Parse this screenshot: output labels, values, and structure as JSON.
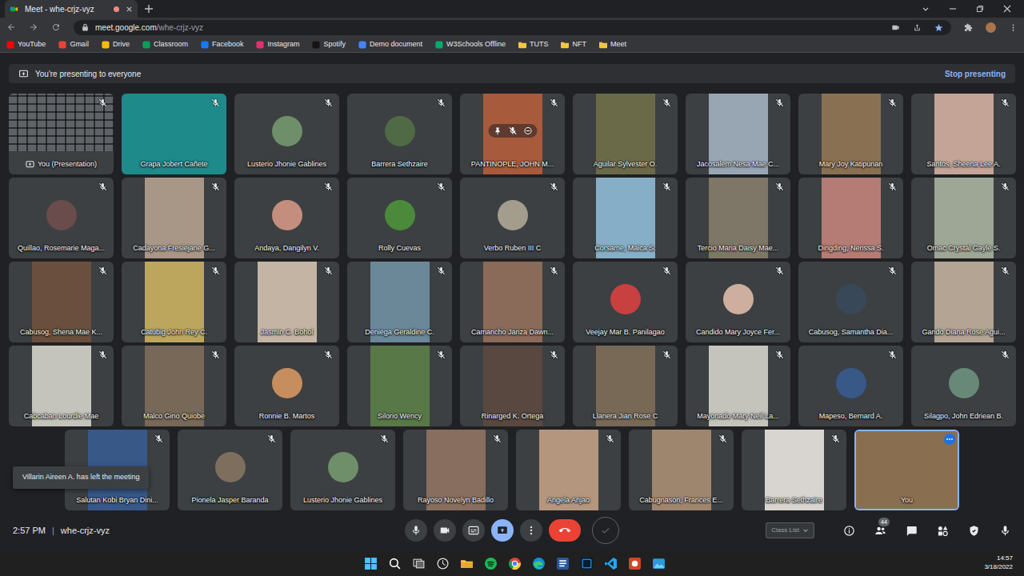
{
  "browser": {
    "tab": {
      "title": "Meet - whe-crjz-vyz",
      "recording": true
    },
    "address": {
      "host": "meet.google.com",
      "path": "/whe-crjz-vyz"
    },
    "bookmarks": [
      {
        "label": "YouTube",
        "kind": "site",
        "color": "#ff0000"
      },
      {
        "label": "Gmail",
        "kind": "site",
        "color": "#ea4335"
      },
      {
        "label": "Drive",
        "kind": "site",
        "color": "#fbbc04"
      },
      {
        "label": "Classroom",
        "kind": "site",
        "color": "#0f9d58"
      },
      {
        "label": "Facebook",
        "kind": "site",
        "color": "#1877f2"
      },
      {
        "label": "Instagram",
        "kind": "site",
        "color": "#e1306c"
      },
      {
        "label": "Spotify",
        "kind": "site",
        "color": "#191414"
      },
      {
        "label": "Demo document",
        "kind": "site",
        "color": "#4285f4"
      },
      {
        "label": "W3Schools Offline",
        "kind": "site",
        "color": "#04aa6d"
      },
      {
        "label": "TUTS",
        "kind": "folder",
        "color": "#f4c542"
      },
      {
        "label": "NFT",
        "kind": "folder",
        "color": "#f4c542"
      },
      {
        "label": "Meet",
        "kind": "folder",
        "color": "#f4c542"
      }
    ]
  },
  "meet": {
    "banner": {
      "text": "You're presenting to everyone",
      "action": "Stop presenting"
    },
    "tiles": [
      {
        "name": "You (Presentation)",
        "kind": "screen",
        "muted": true,
        "selected": false,
        "hovered": false,
        "color": "#5f6368"
      },
      {
        "name": "Grapa Jobert Cañete",
        "kind": "wide",
        "muted": true,
        "selected": false,
        "hovered": false,
        "color": "#1f8a8a"
      },
      {
        "name": "Lusterio Jhonie Gablines",
        "kind": "avatar",
        "muted": true,
        "selected": false,
        "hovered": false,
        "color": "#6f8f6a"
      },
      {
        "name": "Barrera Sethzaire",
        "kind": "avatar",
        "muted": true,
        "selected": false,
        "hovered": false,
        "color": "#4f6a45"
      },
      {
        "name": "PANTINOPLE, JOHN M...",
        "kind": "portrait",
        "muted": true,
        "selected": false,
        "hovered": true,
        "color": "#a85a3c"
      },
      {
        "name": "Aguilar Sylvester O.",
        "kind": "portrait",
        "muted": true,
        "selected": false,
        "hovered": false,
        "color": "#6b6a48"
      },
      {
        "name": "Jacosalem Nesa Mae C...",
        "kind": "portrait",
        "muted": true,
        "selected": false,
        "hovered": false,
        "color": "#98a6b4"
      },
      {
        "name": "Mary Joy Katipunan",
        "kind": "portrait",
        "muted": true,
        "selected": false,
        "hovered": false,
        "color": "#8a7052"
      },
      {
        "name": "Santos, Sheena Lee A.",
        "kind": "portrait",
        "muted": true,
        "selected": false,
        "hovered": false,
        "color": "#c4a496"
      },
      {
        "name": "Quillao, Rosemarie Maga...",
        "kind": "avatar",
        "muted": true,
        "selected": false,
        "hovered": false,
        "color": "#6a4c4c"
      },
      {
        "name": "Cadayona Fresiejane G...",
        "kind": "portrait",
        "muted": true,
        "selected": false,
        "hovered": false,
        "color": "#a89686"
      },
      {
        "name": "Andaya, Dangilyn V.",
        "kind": "avatar",
        "muted": true,
        "selected": false,
        "hovered": false,
        "color": "#c48e7e"
      },
      {
        "name": "Rolly Cuevas",
        "kind": "avatar",
        "muted": true,
        "selected": false,
        "hovered": false,
        "color": "#4a8a3a"
      },
      {
        "name": "Verbo Ruben III C",
        "kind": "avatar",
        "muted": true,
        "selected": false,
        "hovered": false,
        "color": "#a49c8c"
      },
      {
        "name": "Corsame, Maica S.",
        "kind": "portrait",
        "muted": true,
        "selected": false,
        "hovered": false,
        "color": "#86aec6"
      },
      {
        "name": "Tercio Maria Daisy Mae...",
        "kind": "portrait",
        "muted": true,
        "selected": false,
        "hovered": false,
        "color": "#7e7666"
      },
      {
        "name": "Dingding, Nerissa S.",
        "kind": "portrait",
        "muted": true,
        "selected": false,
        "hovered": false,
        "color": "#b47c74"
      },
      {
        "name": "Omac Crystal Gayle S.",
        "kind": "portrait",
        "muted": true,
        "selected": false,
        "hovered": false,
        "color": "#9ea696"
      },
      {
        "name": "Cabusog, Shena Mae K...",
        "kind": "portrait",
        "muted": true,
        "selected": false,
        "hovered": false,
        "color": "#6a4e3e"
      },
      {
        "name": "Catubig John Rey C.",
        "kind": "portrait",
        "muted": true,
        "selected": false,
        "hovered": false,
        "color": "#bca65e"
      },
      {
        "name": "Jasmin C. Bohol",
        "kind": "portrait",
        "muted": true,
        "selected": false,
        "hovered": false,
        "color": "#c4b4a4"
      },
      {
        "name": "Deniega Geraldine C.",
        "kind": "portrait",
        "muted": true,
        "selected": false,
        "hovered": false,
        "color": "#6a8898"
      },
      {
        "name": "Camancho Jariza Dawn...",
        "kind": "portrait",
        "muted": true,
        "selected": false,
        "hovered": false,
        "color": "#8a6a58"
      },
      {
        "name": "Veejay Mar B. Panilagao",
        "kind": "avatar",
        "muted": true,
        "selected": false,
        "hovered": false,
        "color": "#c84040"
      },
      {
        "name": "Candido Mary Joyce Fer...",
        "kind": "avatar",
        "muted": true,
        "selected": false,
        "hovered": false,
        "color": "#ceae9e"
      },
      {
        "name": "Cabusog, Samantha Dia...",
        "kind": "avatar",
        "muted": true,
        "selected": false,
        "hovered": false,
        "color": "#384858"
      },
      {
        "name": "Gando Diana Rose Agui...",
        "kind": "portrait",
        "muted": true,
        "selected": false,
        "hovered": false,
        "color": "#b4a494"
      },
      {
        "name": "Cabcaban Lourdie Mae",
        "kind": "portrait",
        "muted": true,
        "selected": false,
        "hovered": false,
        "color": "#c4c4bc"
      },
      {
        "name": "Malco Gino Quiobe",
        "kind": "portrait",
        "muted": true,
        "selected": false,
        "hovered": false,
        "color": "#786858"
      },
      {
        "name": "Ronnie B. Martos",
        "kind": "avatar",
        "muted": true,
        "selected": false,
        "hovered": false,
        "color": "#c68e5e"
      },
      {
        "name": "Silorio Wency",
        "kind": "portrait",
        "muted": true,
        "selected": false,
        "hovered": false,
        "color": "#587848"
      },
      {
        "name": "Rinarged K. Ortega",
        "kind": "portrait",
        "muted": true,
        "selected": false,
        "hovered": false,
        "color": "#584840"
      },
      {
        "name": "Llanera Jian Rose C",
        "kind": "portrait",
        "muted": true,
        "selected": false,
        "hovered": false,
        "color": "#786856"
      },
      {
        "name": "Mayonado Mary Neil La...",
        "kind": "portrait",
        "muted": true,
        "selected": false,
        "hovered": false,
        "color": "#c4c4bc"
      },
      {
        "name": "Mapeso, Bernard A.",
        "kind": "avatar",
        "muted": true,
        "selected": false,
        "hovered": false,
        "color": "#385888"
      },
      {
        "name": "Silagpo, John Edriean B.",
        "kind": "avatar",
        "muted": true,
        "selected": false,
        "hovered": false,
        "color": "#688878"
      }
    ],
    "bottom_tiles": [
      {
        "name": "Salutan Kobi Bryan Dini...",
        "kind": "portrait",
        "muted": true,
        "selected": false,
        "hovered": false,
        "color": "#385888"
      },
      {
        "name": "Pionela Jasper Baranda",
        "kind": "avatar",
        "muted": true,
        "selected": false,
        "hovered": false,
        "color": "#7e6e5e"
      },
      {
        "name": "Lusterio Jhonie Gablines",
        "kind": "avatar",
        "muted": true,
        "selected": false,
        "hovered": false,
        "color": "#6f8f6a"
      },
      {
        "name": "Rayoso Novelyn Badillo",
        "kind": "portrait",
        "muted": true,
        "selected": false,
        "hovered": false,
        "color": "#886e5e"
      },
      {
        "name": "Angela Anjao",
        "kind": "portrait",
        "muted": true,
        "selected": false,
        "hovered": false,
        "color": "#b4967e"
      },
      {
        "name": "Cabugnason, Frances E...",
        "kind": "portrait",
        "muted": true,
        "selected": false,
        "hovered": false,
        "color": "#9e866e"
      },
      {
        "name": "Barrera Sethzaire",
        "kind": "portrait",
        "muted": true,
        "selected": false,
        "hovered": false,
        "color": "#d8d4d0"
      },
      {
        "name": "You",
        "kind": "wide",
        "muted": false,
        "selected": true,
        "hovered": false,
        "color": "#8a6e50"
      }
    ],
    "toast": "Villarin Aireen A. has left the meeting",
    "time": "2:57 PM",
    "separator": "|",
    "code": "whe-crjz-vyz",
    "controls": [
      {
        "selected": false
      },
      {
        "selected": false
      },
      {
        "selected": false
      },
      {
        "selected": true
      },
      {
        "selected": false
      },
      {
        "selected": false
      },
      {
        "selected": false
      }
    ],
    "people_count": "44",
    "overlay": "Class List"
  },
  "taskbar": {
    "time": "14:57",
    "date": "3/18/2022"
  }
}
